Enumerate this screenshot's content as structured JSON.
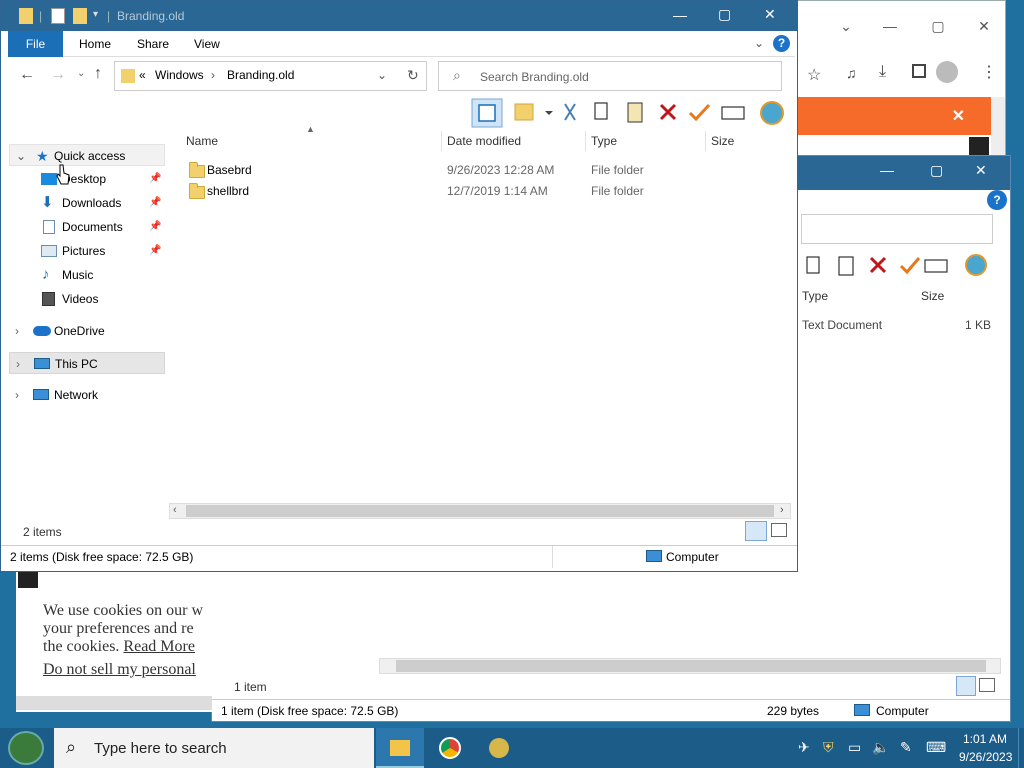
{
  "main_window": {
    "title": "Branding.old",
    "ribbon_tabs": [
      "File",
      "Home",
      "Share",
      "View"
    ],
    "address": {
      "chevron": "«",
      "parts": [
        "Windows",
        "Branding.old"
      ]
    },
    "search_placeholder": "Search Branding.old",
    "nav": [
      {
        "label": "Quick access",
        "icon": "star-icon",
        "pinned": false
      },
      {
        "label": "Desktop",
        "icon": "desktop-icon",
        "pinned": true
      },
      {
        "label": "Downloads",
        "icon": "download-icon",
        "pinned": true
      },
      {
        "label": "Documents",
        "icon": "document-icon",
        "pinned": true
      },
      {
        "label": "Pictures",
        "icon": "pictures-icon",
        "pinned": true
      },
      {
        "label": "Music",
        "icon": "music-icon",
        "pinned": false
      },
      {
        "label": "Videos",
        "icon": "videos-icon",
        "pinned": false
      },
      {
        "label": "OneDrive",
        "icon": "cloud-icon",
        "pinned": false
      },
      {
        "label": "This PC",
        "icon": "computer-icon",
        "pinned": false
      },
      {
        "label": "Network",
        "icon": "network-icon",
        "pinned": false
      }
    ],
    "columns": [
      "Name",
      "Date modified",
      "Type",
      "Size"
    ],
    "files": [
      {
        "name": "Basebrd",
        "date": "9/26/2023 12:28 AM",
        "type": "File folder",
        "size": ""
      },
      {
        "name": "shellbrd",
        "date": "12/7/2019 1:14 AM",
        "type": "File folder",
        "size": ""
      }
    ],
    "item_count": "2 items",
    "status": "2 items (Disk free space: 72.5 GB)",
    "status_location": "Computer"
  },
  "back_window": {
    "columns": [
      "Type",
      "Size"
    ],
    "files": [
      {
        "type": "Text Document",
        "size": "1 KB"
      }
    ],
    "item_count": "1 item",
    "status": "1 item (Disk free space: 72.5 GB)",
    "size_text": "229 bytes",
    "status_location": "Computer"
  },
  "cookie_banner": {
    "lines": [
      "We use cookies on our w",
      "your preferences and re",
      "the cookies."
    ],
    "read_more": "Read More",
    "do_not_sell": "Do not sell my personal"
  },
  "taskbar": {
    "search_placeholder": "Type here to search",
    "time": "1:01 AM",
    "date": "9/26/2023"
  },
  "colors": {
    "accent": "#2a6794",
    "orange": "#f66a2a",
    "taskbar": "#1c5c89"
  }
}
